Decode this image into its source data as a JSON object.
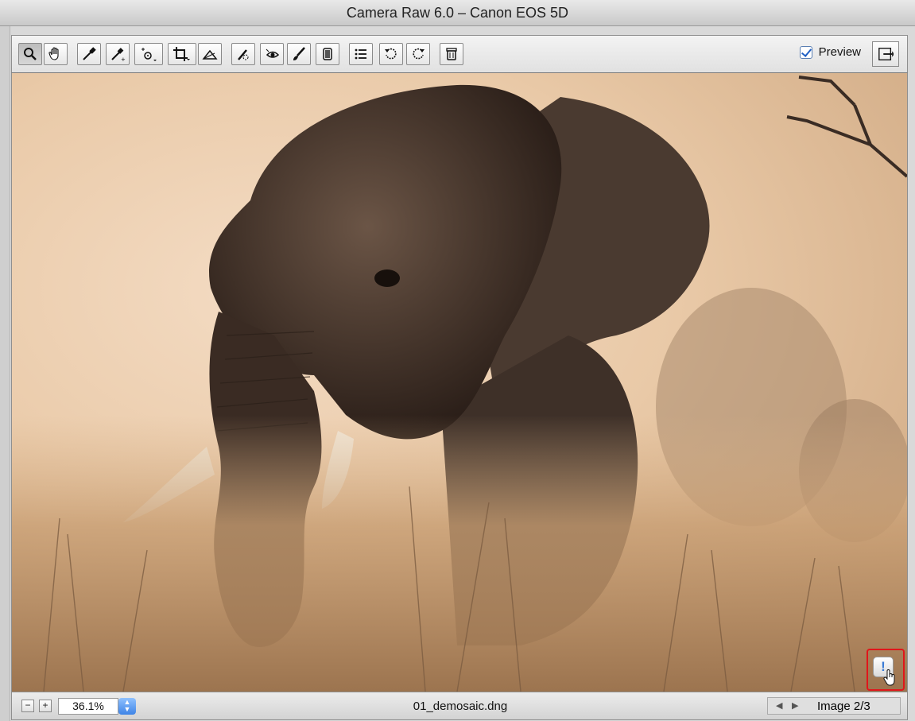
{
  "window": {
    "title": "Camera Raw 6.0  –  Canon EOS 5D"
  },
  "toolbar": {
    "tools": [
      {
        "name": "zoom-tool",
        "icon": "magnifier-icon",
        "active": true
      },
      {
        "name": "hand-tool",
        "icon": "hand-icon"
      },
      {
        "name": "white-balance-tool",
        "icon": "eyedropper-icon"
      },
      {
        "name": "color-sampler-tool",
        "icon": "color-sampler-icon"
      },
      {
        "name": "targeted-adjustment-tool",
        "icon": "target-adjust-icon"
      },
      {
        "name": "crop-tool",
        "icon": "crop-icon"
      },
      {
        "name": "straighten-tool",
        "icon": "straighten-icon"
      },
      {
        "name": "spot-removal-tool",
        "icon": "spot-removal-icon"
      },
      {
        "name": "red-eye-tool",
        "icon": "red-eye-icon"
      },
      {
        "name": "adjustment-brush-tool",
        "icon": "brush-icon"
      },
      {
        "name": "graduated-filter-tool",
        "icon": "graduated-filter-icon"
      },
      {
        "name": "preferences-button",
        "icon": "list-icon"
      },
      {
        "name": "rotate-left-button",
        "icon": "rotate-ccw-icon"
      },
      {
        "name": "rotate-right-button",
        "icon": "rotate-cw-icon"
      },
      {
        "name": "delete-button",
        "icon": "trash-icon"
      }
    ],
    "preview_label": "Preview",
    "preview_checked": true
  },
  "canvas": {
    "subject": "elephant-photo-sepia"
  },
  "status": {
    "zoom_value": "36.1%",
    "filename": "01_demosaic.dng",
    "image_counter": "Image 2/3"
  },
  "warning_badge": {
    "symbol": "!",
    "highlight_color": "#e0161b"
  },
  "colors": {
    "accent": "#3f84e6",
    "sepia_light": "#f0d6bc",
    "sepia_dark": "#3a2c24"
  }
}
